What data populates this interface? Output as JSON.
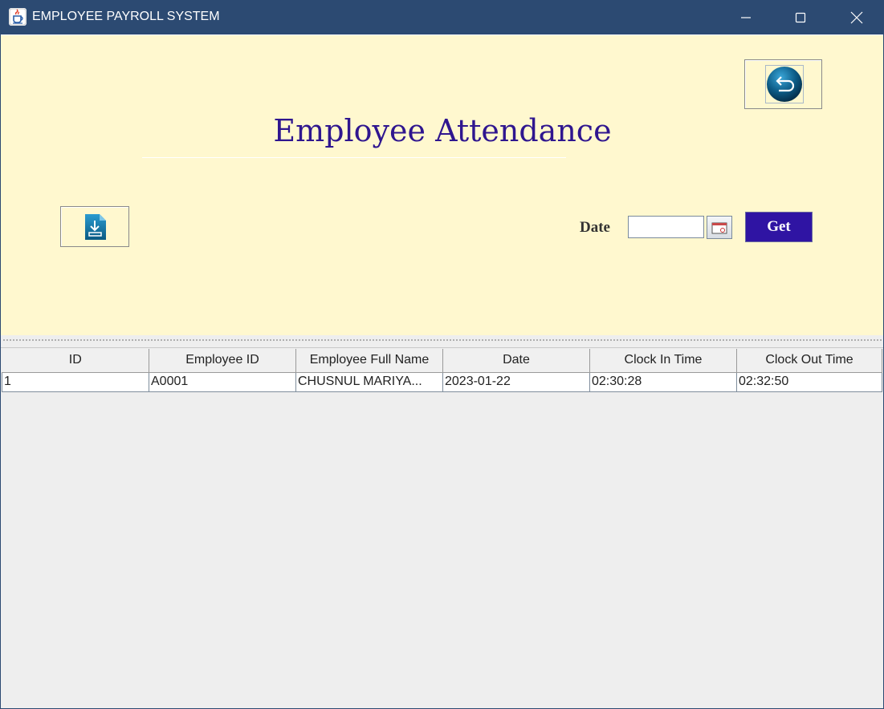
{
  "window": {
    "title": "EMPLOYEE PAYROLL SYSTEM"
  },
  "page": {
    "title": "Employee Attendance"
  },
  "filter": {
    "date_label": "Date",
    "date_value": "",
    "get_label": "Get"
  },
  "icons": {
    "app": "java-cup-icon",
    "back": "back-arrow-icon",
    "export": "download-document-icon",
    "calendar": "calendar-icon",
    "minimize": "minimize-icon",
    "maximize": "maximize-icon",
    "close": "close-icon"
  },
  "colors": {
    "titlebar": "#2c4a72",
    "panel_background": "#fff8cf",
    "title_text": "#2f168f",
    "get_button": "#2f14a3"
  },
  "table": {
    "columns": [
      "ID",
      "Employee ID",
      "Employee Full Name",
      "Date",
      "Clock In Time",
      "Clock Out Time"
    ],
    "rows": [
      [
        "1",
        "A0001",
        "CHUSNUL MARIYA...",
        "2023-01-22",
        "02:30:28",
        "02:32:50"
      ]
    ]
  }
}
